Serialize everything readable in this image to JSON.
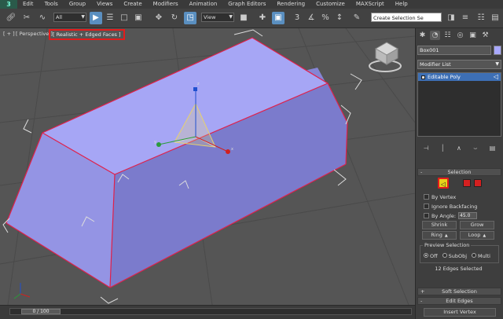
{
  "menubar": {
    "logo": "3",
    "items": [
      "Edit",
      "Tools",
      "Group",
      "Views",
      "Create",
      "Modifiers",
      "Animation",
      "Graph Editors",
      "Rendering",
      "Customize",
      "MAXScript",
      "Help"
    ]
  },
  "toolbar": {
    "selection_filter": "All",
    "ref_coord": "View",
    "selection_set_placeholder": "Create Selection Se",
    "snaps_label": "3",
    "angle_snap_label": "%"
  },
  "viewport": {
    "label_plus": "[ + ]",
    "label_view": "[ Perspective ]",
    "label_shading": "[ Realistic + Edged Faces ]",
    "gizmo_axis_z": "z",
    "gizmo_axis_x": "x",
    "gizmo_axis_y": "y",
    "colors": {
      "background": "#555555",
      "top_face": "#a6a6f5",
      "front_face": "#8f8fdf",
      "side_face": "#7777c8",
      "selected_edge": "#e0204a",
      "shading_label_border": "#e31c1c"
    }
  },
  "command_panel": {
    "tabs": [
      "create-icon",
      "modify-icon",
      "hierarchy-icon",
      "motion-icon",
      "display-icon",
      "utilities-icon"
    ],
    "object_name": "Box001",
    "object_color": "#a9a9ff",
    "modifier_list": "Modifier List",
    "stack_items": [
      "Editable Poly"
    ],
    "selection_rollout": {
      "title": "Selection",
      "by_vertex": "By Vertex",
      "ignore_backfacing": "Ignore Backfacing",
      "by_angle": "By Angle:",
      "angle_value": "45.0",
      "shrink": "Shrink",
      "grow": "Grow",
      "ring": "Ring",
      "loop": "Loop",
      "preview_group": "Preview Selection",
      "preview_off": "Off",
      "preview_subobj": "SubObj",
      "preview_multi": "Multi",
      "status": "12 Edges Selected"
    },
    "soft_selection": "Soft Selection",
    "edit_edges": "Edit Edges",
    "insert_vertex": "Insert Vertex"
  },
  "timeline": {
    "frame": "0 / 100"
  }
}
